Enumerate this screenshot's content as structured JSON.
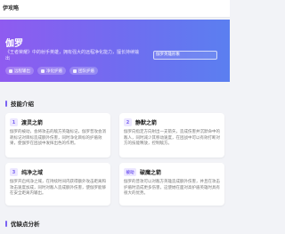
{
  "header": {
    "title": "伊攻略"
  },
  "hero": {
    "name": "伽罗",
    "description": "《王者荣耀》中的射手英雄，拥有强大的远程净化能力，擅长持续输出",
    "chips": [
      "远程输出",
      "净化护盾",
      "团队护盾"
    ],
    "image_alt": "伽罗英雄形象"
  },
  "skills": {
    "title": "技能介绍",
    "cards": [
      {
        "num": "1",
        "title": "渡灵之箭",
        "body": "伽罗的被动，会将攻击的敌方英雄标记，伽罗普攻会消耗标记对目标造成额外伤害，同时净化目标的护盾效果，使伽罗在团战中发挥出色的作用。"
      },
      {
        "num": "2",
        "title": "静默之箭",
        "body": "伽罗向指定方向射出一支箭矢，造成伤害并沉默命中的敌人，同时减少其移动速度，在团战中可以有效打断对方的技能释放，控制敌方。"
      },
      {
        "num": "3",
        "title": "纯净之域",
        "body": "伽罗开启纯净之域，在持续时间内获得额外攻击距离和攻击速度加成，同时对敌人造成额外伤害，使伽罗能够在安全距离内输出。"
      },
      {
        "num": "被动",
        "title": "破魔之箭",
        "body": "伽罗的普攻可以对敌方英雄造成额外伤害，并且在攻击护盾时造成更多伤害，这使她在面对高护盾英雄时具有很大的优势。"
      }
    ]
  },
  "analysis": {
    "title": "优缺点分析"
  }
}
